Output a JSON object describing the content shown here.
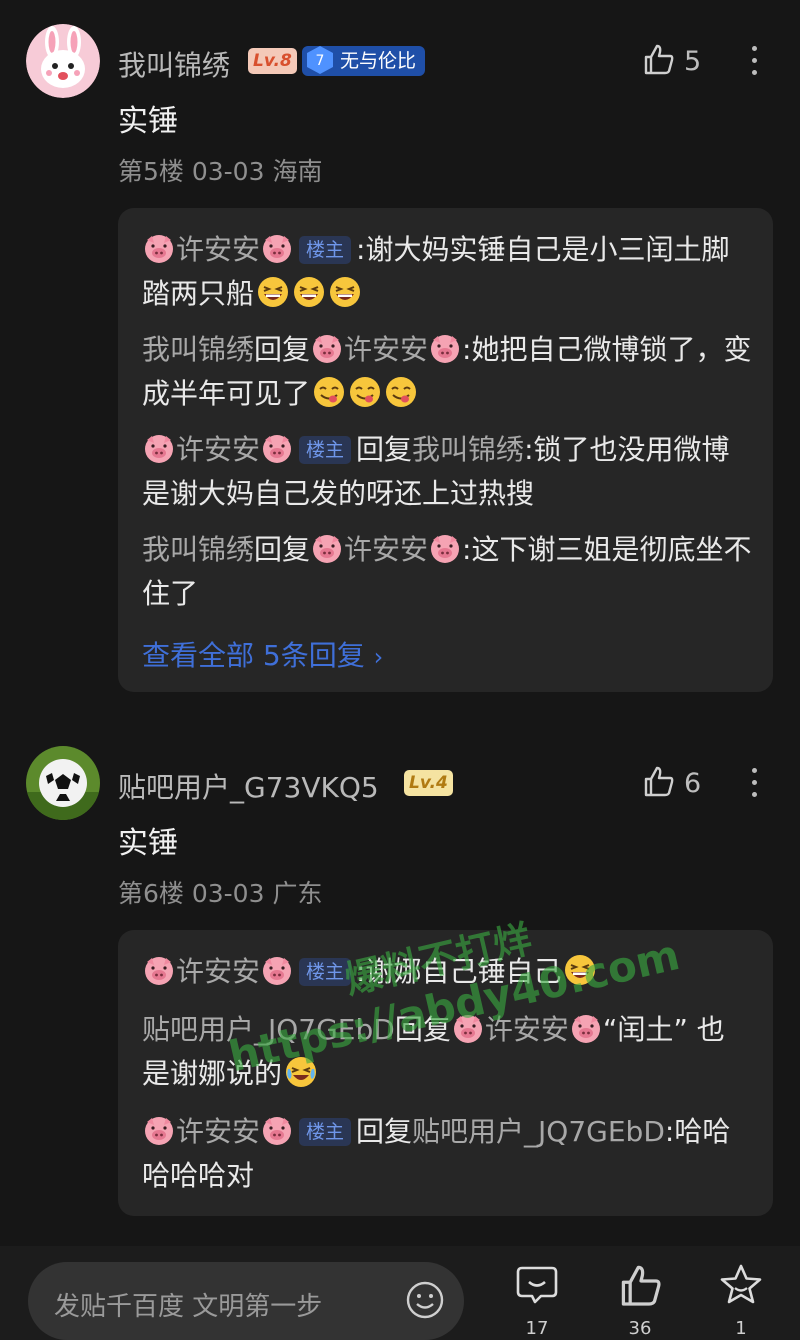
{
  "post1": {
    "username": "我叫锦绣",
    "level": "Lv.8",
    "title_badge_num": "7",
    "title_badge_text": "无与伦比",
    "like_count": "5",
    "content": "实锤",
    "meta": "第5楼 03-03 海南",
    "replies": [
      {
        "author": "许安安",
        "is_host": true,
        "host_label": "楼主",
        "reply_to": "",
        "text": ":谢大妈实锤自己是小三闰土脚踏两只船",
        "emoji": "grinning-squint-face"
      },
      {
        "author": "我叫锦绣",
        "is_host": false,
        "host_label": "",
        "reply_word": "回复",
        "reply_to": "许安安",
        "text": ":她把自己微博锁了，变成半年可见了",
        "emoji": "yum-face"
      },
      {
        "author": "许安安",
        "is_host": true,
        "host_label": "楼主",
        "reply_word": "回复",
        "reply_to": "我叫锦绣",
        "text": ":锁了也没用微博是谢大妈自己发的呀还上过热搜"
      },
      {
        "author": "我叫锦绣",
        "is_host": false,
        "host_label": "",
        "reply_word": "回复",
        "reply_to": "许安安",
        "text": ":这下谢三姐是彻底坐不住了"
      }
    ],
    "view_all": "查看全部 5条回复"
  },
  "post2": {
    "username": "贴吧用户_G73VKQ5",
    "level": "Lv.4",
    "like_count": "6",
    "content": "实锤",
    "meta": "第6楼 03-03 广东",
    "replies": [
      {
        "author": "许安安",
        "is_host": true,
        "host_label": "楼主",
        "text": ":谢娜自己锤自己",
        "emoji": "grinning-squint-face"
      },
      {
        "author": "贴吧用户_JQ7GEbD",
        "reply_word": "回复",
        "reply_to": "许安安",
        "text": "“闰土” 也是谢娜说的",
        "emoji": "crying-laughing-face"
      },
      {
        "author": "许安安",
        "is_host": true,
        "host_label": "楼主",
        "reply_word": "回复",
        "reply_to": "贴吧用户_JQ7GEbD",
        "text": ":哈哈哈哈哈对"
      }
    ]
  },
  "watermark": {
    "line1": "爆料不打烊",
    "line2": "https://abdy40.com"
  },
  "bottom_bar": {
    "input_placeholder": "发贴千百度 文明第一步",
    "comment_count": "17",
    "like_count": "36",
    "favorite_count": "1"
  },
  "colors": {
    "background": "#161616",
    "card": "#262626",
    "link": "#3f6fd8",
    "host_badge": "#6f96e9"
  }
}
